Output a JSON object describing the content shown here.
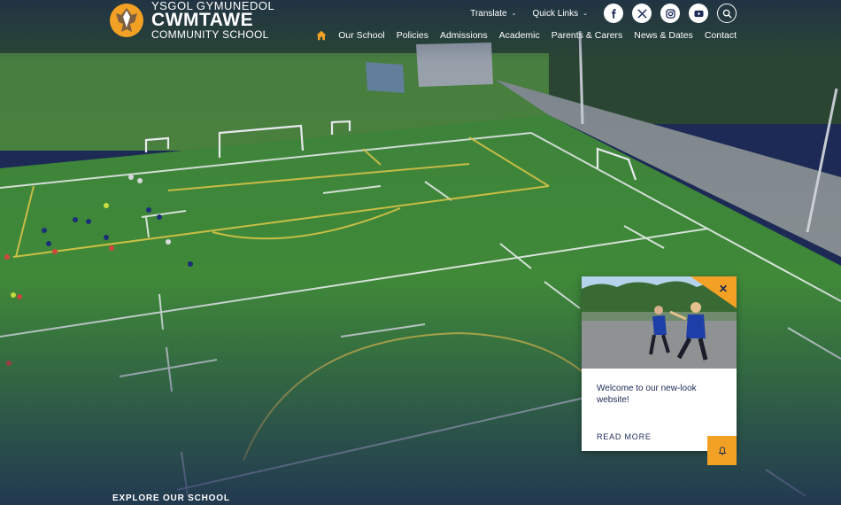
{
  "brand": {
    "line1": "YSGOL GYMUNEDOL",
    "line2": "CWMTAWE",
    "line3": "COMMUNITY SCHOOL"
  },
  "utility": {
    "translate": "Translate",
    "quick_links": "Quick Links",
    "social": [
      "facebook-icon",
      "x-icon",
      "instagram-icon",
      "youtube-icon"
    ]
  },
  "nav": {
    "items": [
      "Our School",
      "Policies",
      "Admissions",
      "Academic",
      "Parents & Carers",
      "News & Dates",
      "Contact"
    ]
  },
  "hero": {
    "explore": "EXPLORE OUR SCHOOL"
  },
  "popup": {
    "message": "Welcome to our new-look website!",
    "read_more": "READ MORE"
  },
  "colors": {
    "accent": "#f2a125",
    "navy": "#1d2a57",
    "pitch": "#3f8a36"
  }
}
